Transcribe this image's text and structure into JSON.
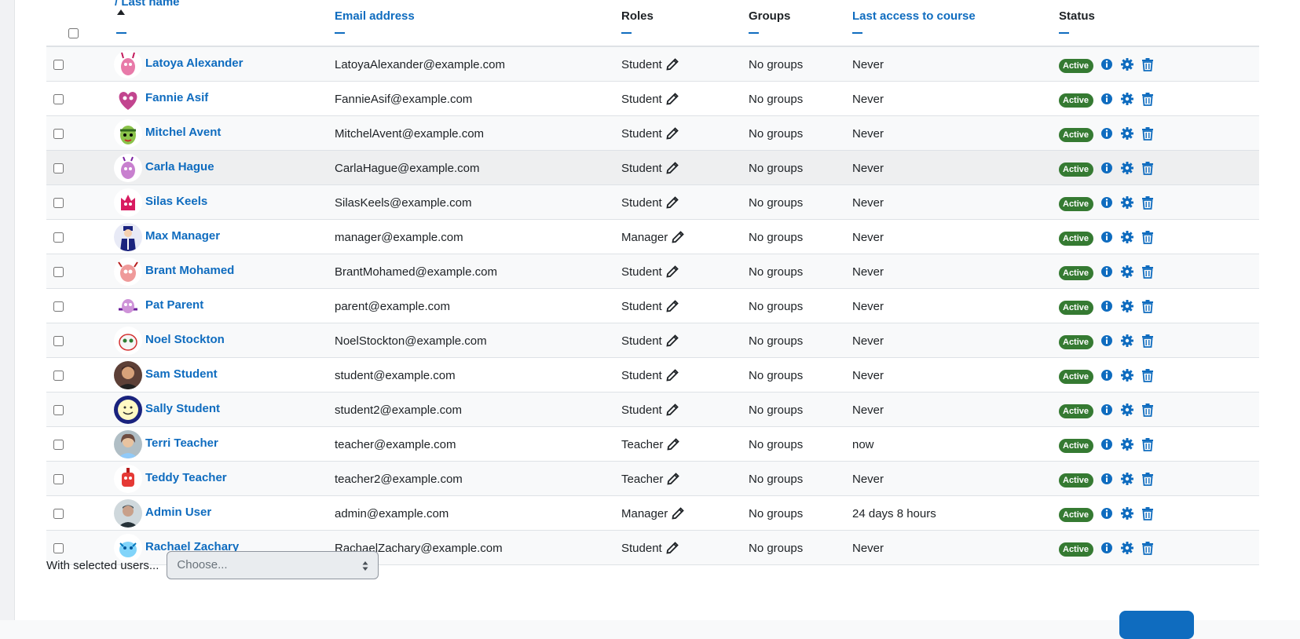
{
  "headers": {
    "first_name": "/ Last name",
    "email": "Email address",
    "roles": "Roles",
    "groups": "Groups",
    "last_access": "Last access to course",
    "status": "Status"
  },
  "rows": [
    {
      "name": "Latoya Alexander",
      "email": "LatoyaAlexander@example.com",
      "role": "Student",
      "groups": "No groups",
      "last_access": "Never",
      "status": "Active",
      "avatar": "monster-pink"
    },
    {
      "name": "Fannie Asif",
      "email": "FannieAsif@example.com",
      "role": "Student",
      "groups": "No groups",
      "last_access": "Never",
      "status": "Active",
      "avatar": "monster-heart"
    },
    {
      "name": "Mitchel Avent",
      "email": "MitchelAvent@example.com",
      "role": "Student",
      "groups": "No groups",
      "last_access": "Never",
      "status": "Active",
      "avatar": "monster-green"
    },
    {
      "name": "Carla Hague",
      "email": "CarlaHague@example.com",
      "role": "Student",
      "groups": "No groups",
      "last_access": "Never",
      "status": "Active",
      "avatar": "monster-purple"
    },
    {
      "name": "Silas Keels",
      "email": "SilasKeels@example.com",
      "role": "Student",
      "groups": "No groups",
      "last_access": "Never",
      "status": "Active",
      "avatar": "monster-magenta"
    },
    {
      "name": "Max Manager",
      "email": "manager@example.com",
      "role": "Manager",
      "groups": "No groups",
      "last_access": "Never",
      "status": "Active",
      "avatar": "person-suit"
    },
    {
      "name": "Brant Mohamed",
      "email": "BrantMohamed@example.com",
      "role": "Student",
      "groups": "No groups",
      "last_access": "Never",
      "status": "Active",
      "avatar": "monster-red"
    },
    {
      "name": "Pat Parent",
      "email": "parent@example.com",
      "role": "Student",
      "groups": "No groups",
      "last_access": "Never",
      "status": "Active",
      "avatar": "monster-violet"
    },
    {
      "name": "Noel Stockton",
      "email": "NoelStockton@example.com",
      "role": "Student",
      "groups": "No groups",
      "last_access": "Never",
      "status": "Active",
      "avatar": "monster-white"
    },
    {
      "name": "Sam Student",
      "email": "student@example.com",
      "role": "Student",
      "groups": "No groups",
      "last_access": "Never",
      "status": "Active",
      "avatar": "photo-man"
    },
    {
      "name": "Sally Student",
      "email": "student2@example.com",
      "role": "Student",
      "groups": "No groups",
      "last_access": "Never",
      "status": "Active",
      "avatar": "smiley-face"
    },
    {
      "name": "Terri Teacher",
      "email": "teacher@example.com",
      "role": "Teacher",
      "groups": "No groups",
      "last_access": "now",
      "status": "Active",
      "avatar": "photo-woman"
    },
    {
      "name": "Teddy Teacher",
      "email": "teacher2@example.com",
      "role": "Teacher",
      "groups": "No groups",
      "last_access": "Never",
      "status": "Active",
      "avatar": "monster-robot"
    },
    {
      "name": "Admin User",
      "email": "admin@example.com",
      "role": "Manager",
      "groups": "No groups",
      "last_access": "24 days 8 hours",
      "status": "Active",
      "avatar": "photo-admin"
    },
    {
      "name": "Rachael Zachary",
      "email": "RachaelZachary@example.com",
      "role": "Student",
      "groups": "No groups",
      "last_access": "Never",
      "status": "Active",
      "avatar": "monster-blue"
    }
  ],
  "bulk": {
    "label": "With selected users...",
    "select_value": "Choose..."
  },
  "colors": {
    "link": "#0f6cbf",
    "active_badge": "#357a32",
    "row_alt": "#f8f9fa",
    "row_hover": "#eeeff0"
  },
  "icons": {
    "edit": "pencil-icon",
    "info": "info-icon",
    "settings": "gear-icon",
    "delete": "trash-icon",
    "sort": "sort-asc-icon"
  }
}
